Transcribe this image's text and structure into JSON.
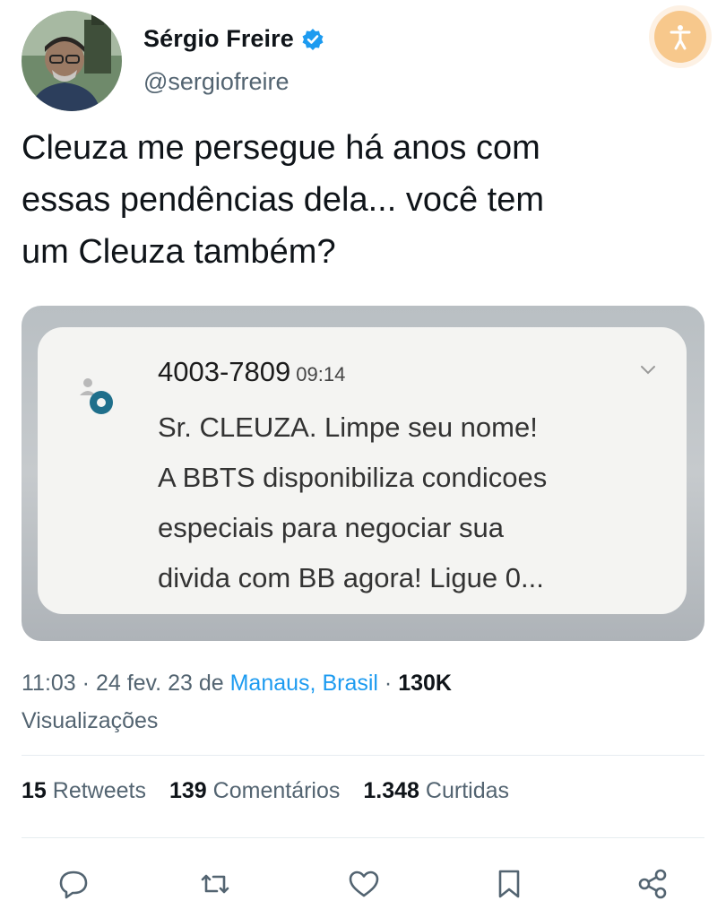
{
  "author": {
    "display_name": "Sérgio Freire",
    "handle": "@sergiofreire",
    "verified": true
  },
  "tweet": {
    "text_line1": "Cleuza me persegue há anos com",
    "text_line2": "essas pendências dela... você tem",
    "text_line3": "um Cleuza também?"
  },
  "notification": {
    "sender": "4003-7809",
    "time": "09:14",
    "body_line1": "Sr. CLEUZA. Limpe seu nome!",
    "body_line2": "A BBTS disponibiliza condicoes",
    "body_line3": "especiais para negociar sua",
    "body_line4": "divida com BB agora! Ligue 0..."
  },
  "meta": {
    "time": "11:03",
    "date": "24 fev. 23",
    "from": "de",
    "place": "Manaus, Brasil",
    "views_count": "130K",
    "views_label": "Visualizações"
  },
  "stats": {
    "retweets_count": "15",
    "retweets_label": "Retweets",
    "comments_count": "139",
    "comments_label": "Comentários",
    "likes_count": "1.348",
    "likes_label": "Curtidas"
  },
  "colors": {
    "link": "#1d9bf0",
    "verified": "#1d9bf0",
    "secondary_text": "#536471",
    "accessibility_badge": "#f7c88c"
  },
  "icons": [
    "reply-icon",
    "retweet-icon",
    "like-icon",
    "bookmark-icon",
    "share-icon",
    "verified-badge-icon",
    "accessibility-icon",
    "chevron-down-icon"
  ]
}
